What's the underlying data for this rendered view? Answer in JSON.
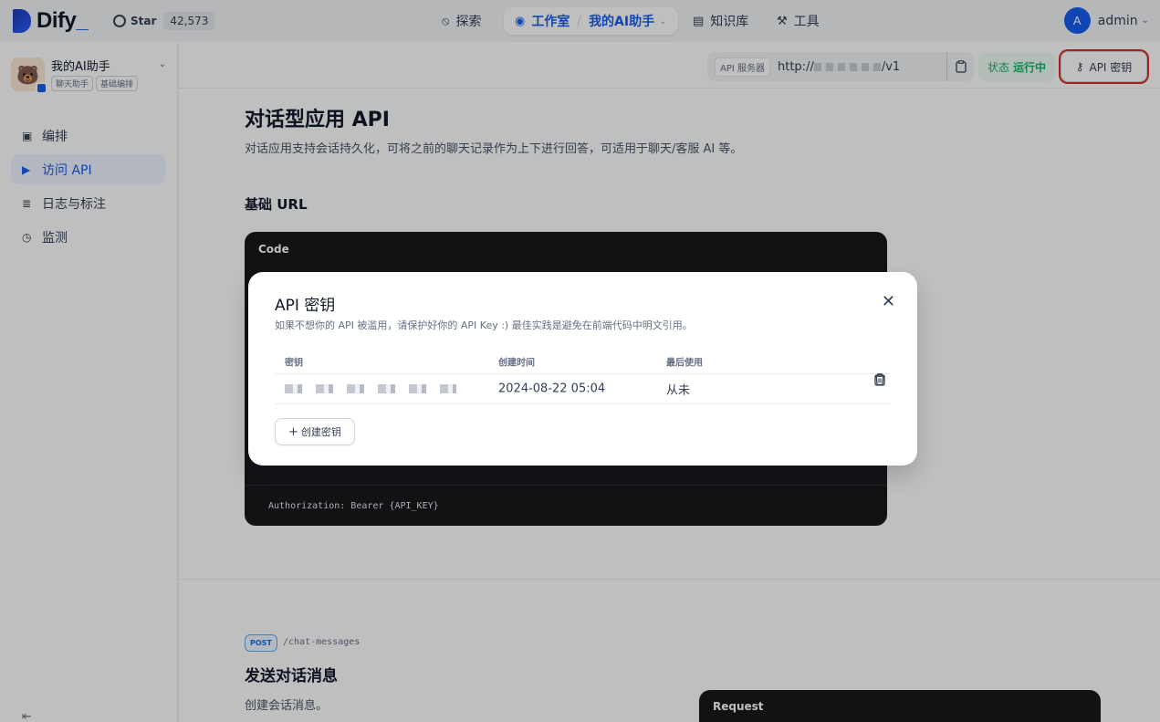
{
  "header": {
    "logo_text": "Dify",
    "github": {
      "star_label": "Star",
      "star_count": "42,573"
    },
    "nav": {
      "explore": "探索",
      "studio": "工作室",
      "current_app": "我的AI助手",
      "knowledge": "知识库",
      "tools": "工具"
    },
    "user": {
      "initial": "A",
      "name": "admin"
    }
  },
  "sidebar": {
    "app_name": "我的AI助手",
    "tags": [
      "聊天助手",
      "基础编排"
    ],
    "items": [
      {
        "label": "编排",
        "icon": "layout-icon",
        "active": false
      },
      {
        "label": "访问 API",
        "icon": "terminal-icon",
        "active": true
      },
      {
        "label": "日志与标注",
        "icon": "log-icon",
        "active": false
      },
      {
        "label": "监测",
        "icon": "monitor-icon",
        "active": false
      }
    ]
  },
  "toolbar": {
    "server_label": "API 服务器",
    "server_url_prefix": "http://",
    "server_url_suffix": "/v1",
    "status_label": "状态",
    "status_value": "运行中",
    "api_key_button": "API 密钥"
  },
  "doc": {
    "title": "对话型应用 API",
    "lead": "对话应用支持会话持久化，可将之前的聊天记录作为上下进行回答，可适用于聊天/客服 AI 等。",
    "base_url_heading": "基础 URL",
    "code_label": "Code",
    "auth_code": "Authorization: Bearer {API_KEY}",
    "method": "POST",
    "endpoint": "/chat-messages",
    "send_heading": "发送对话消息",
    "send_desc": "创建会话消息。",
    "request_label": "Request"
  },
  "modal": {
    "title": "API 密钥",
    "subtitle": "如果不想你的 API 被滥用，请保护好你的 API Key :) 最佳实践是避免在前端代码中明文引用。",
    "columns": [
      "密钥",
      "创建时间",
      "最后使用"
    ],
    "rows": [
      {
        "created": "2024-08-22 05:04",
        "last_used": "从未"
      }
    ],
    "create_button": "创建密钥"
  },
  "colors": {
    "accent": "#155eef",
    "status_green": "#12b76a",
    "highlight_red": "#d92d20",
    "code_bg": "#18181b"
  }
}
